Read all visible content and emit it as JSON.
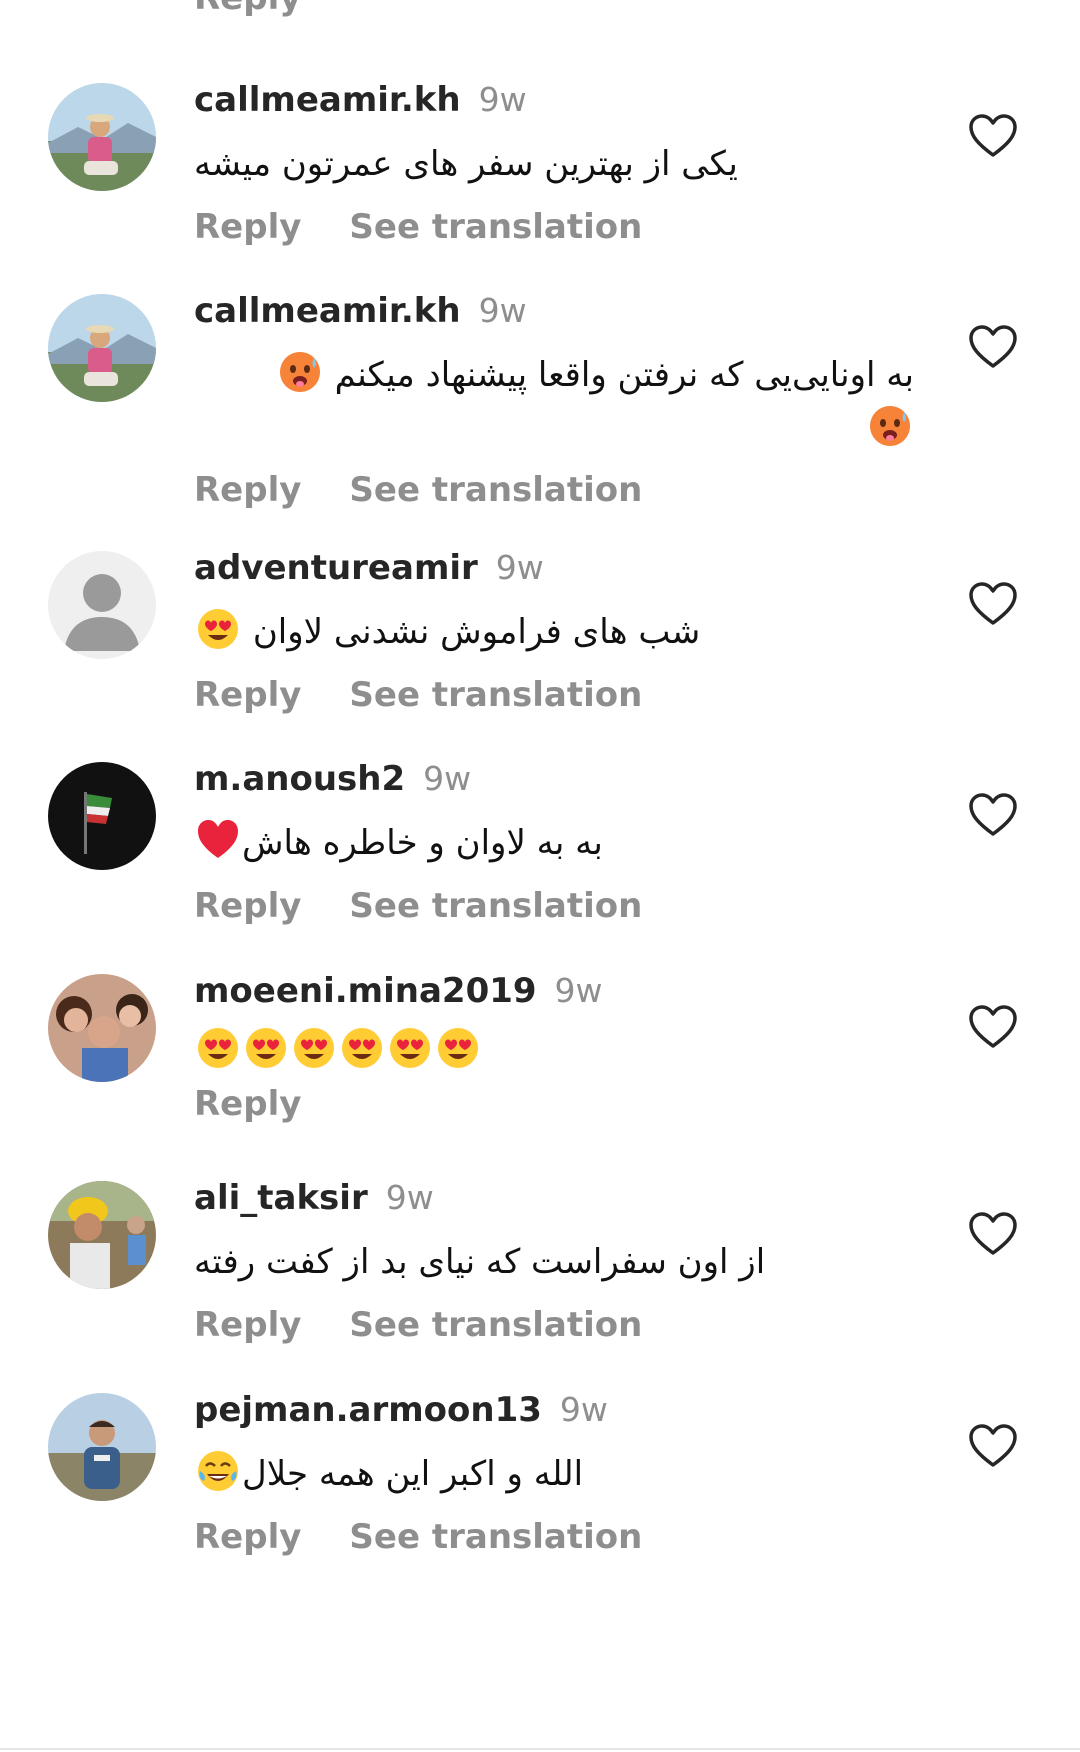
{
  "top_partial": {
    "reply_label": "Reply"
  },
  "comments": [
    {
      "username": "callmeamir.kh",
      "time": "9w",
      "text": "یکی از بهترین سفر های عمرتون میشه",
      "emojis": [],
      "reply_label": "Reply",
      "translation_label": "See translation",
      "avatar": "photo-man-hat-mountain"
    },
    {
      "username": "callmeamir.kh",
      "time": "9w",
      "text": "به اونایی‌یی که نرفتن واقعا پیشنهاد میکنم",
      "emojis": [
        "hot-face-emoji",
        "hot-face-emoji"
      ],
      "reply_label": "Reply",
      "translation_label": "See translation",
      "avatar": "photo-man-hat-mountain"
    },
    {
      "username": "adventureamir",
      "time": "9w",
      "text": "شب های فراموش نشدنی لاوان",
      "emojis": [
        "heart-eyes-emoji"
      ],
      "reply_label": "Reply",
      "translation_label": "See translation",
      "avatar": "default-user-icon"
    },
    {
      "username": "m.anoush2",
      "time": "9w",
      "text": "به به لاوان و خاطره هاش",
      "emojis": [
        "red-heart-emoji"
      ],
      "reply_label": "Reply",
      "translation_label": "See translation",
      "avatar": "photo-dark-flag"
    },
    {
      "username": "moeeni.mina2019",
      "time": "9w",
      "text": "",
      "emojis": [
        "heart-eyes-emoji",
        "heart-eyes-emoji",
        "heart-eyes-emoji",
        "heart-eyes-emoji",
        "heart-eyes-emoji",
        "heart-eyes-emoji"
      ],
      "reply_label": "Reply",
      "translation_label": "",
      "avatar": "photo-group-selfie"
    },
    {
      "username": "ali_taksir",
      "time": "9w",
      "text": "از اون سفراست که نیای بد از کفت رفته",
      "emojis": [],
      "reply_label": "Reply",
      "translation_label": "See translation",
      "avatar": "photo-man-helmet"
    },
    {
      "username": "pejman.armoon13",
      "time": "9w",
      "text": "الله و اکبر این همه جلال",
      "emojis": [
        "tears-of-joy-emoji"
      ],
      "reply_label": "Reply",
      "translation_label": "See translation",
      "avatar": "photo-man-outdoors"
    }
  ],
  "colors": {
    "username": "#262626",
    "secondary": "#8e8e8e",
    "heart_outline": "#262626"
  }
}
